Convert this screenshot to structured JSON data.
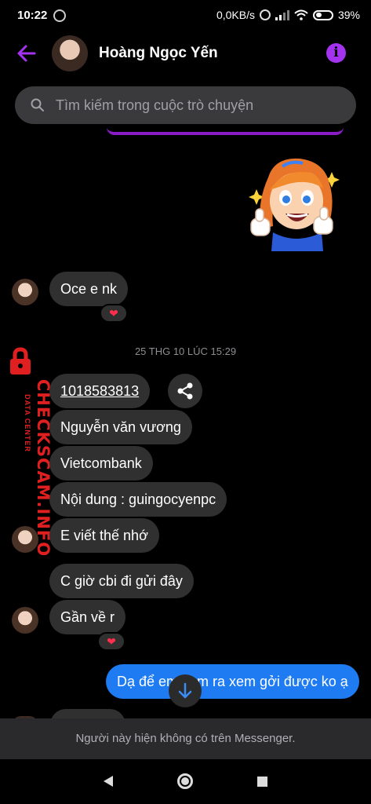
{
  "status_bar": {
    "time": "10:22",
    "network_speed": "0,0KB/s",
    "battery": "39%"
  },
  "header": {
    "contact_name": "Hoàng Ngọc Yến",
    "back_icon": "arrow-left-icon",
    "info_icon": "info-icon",
    "info_glyph": "i"
  },
  "search": {
    "placeholder": "Tìm kiếm trong cuộc trò chuyện"
  },
  "messages": {
    "m1": "Oce e nk",
    "m1_reaction": "❤",
    "timestamp": "25 THG 10 LÚC 15:29",
    "m2": "1018583813",
    "m3": "Nguyễn văn vương",
    "m4": "Vietcombank",
    "m5": "Nội dung : guingocyenpc",
    "m6": "E viết thế nhớ",
    "m7": "C giờ cbi đi gửi đây",
    "m8": "Gần về r",
    "m8_reaction": "❤",
    "m9": "Dạ để em xem ra xem gởi được ko ạ"
  },
  "watermark": {
    "title": "CHECKSCAM.INFO",
    "subtitle": "DATA CENTER"
  },
  "footer": {
    "notice": "Người này hiện không có trên Messenger."
  },
  "colors": {
    "accent": "#a433f0",
    "my_bubble": "#1f7bf2",
    "their_bubble": "#303030",
    "watermark": "#e02020"
  }
}
